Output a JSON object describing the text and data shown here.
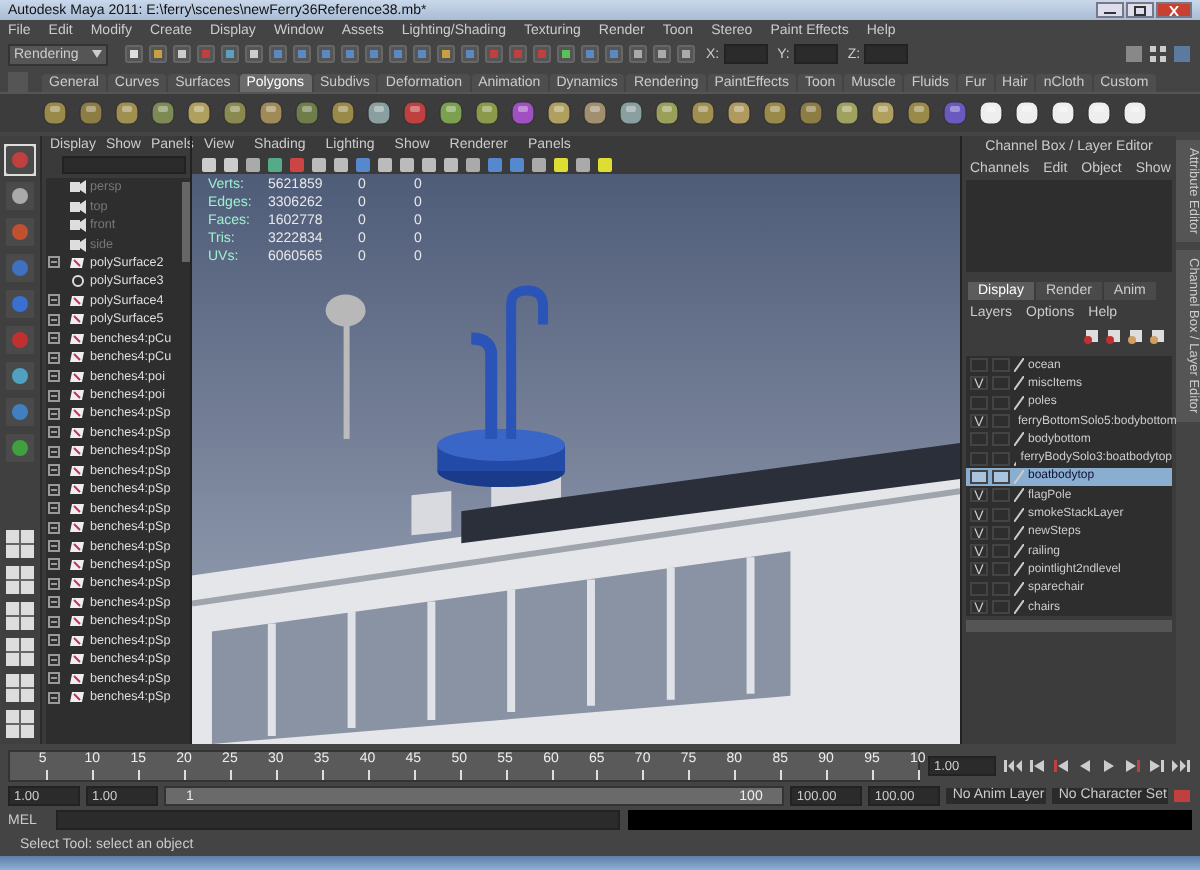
{
  "window": {
    "title": "Autodesk Maya 2011: E:\\ferry\\scenes\\newFerry36Reference38.mb*"
  },
  "menu_bar": [
    "File",
    "Edit",
    "Modify",
    "Create",
    "Display",
    "Window",
    "Assets",
    "Lighting/Shading",
    "Texturing",
    "Render",
    "Toon",
    "Stereo",
    "Paint Effects",
    "Help"
  ],
  "status_line": {
    "mode": "Rendering",
    "coords": [
      "X:",
      "Y:",
      "Z:"
    ]
  },
  "shelf_tabs": [
    {
      "label": "General",
      "selected": false
    },
    {
      "label": "Curves",
      "selected": false
    },
    {
      "label": "Surfaces",
      "selected": false
    },
    {
      "label": "Polygons",
      "selected": true
    },
    {
      "label": "Subdivs",
      "selected": false
    },
    {
      "label": "Deformation",
      "selected": false
    },
    {
      "label": "Animation",
      "selected": false
    },
    {
      "label": "Dynamics",
      "selected": false
    },
    {
      "label": "Rendering",
      "selected": false
    },
    {
      "label": "PaintEffects",
      "selected": false
    },
    {
      "label": "Toon",
      "selected": false
    },
    {
      "label": "Muscle",
      "selected": false
    },
    {
      "label": "Fluids",
      "selected": false
    },
    {
      "label": "Fur",
      "selected": false
    },
    {
      "label": "Hair",
      "selected": false
    },
    {
      "label": "nCloth",
      "selected": false
    },
    {
      "label": "Custom",
      "selected": false
    }
  ],
  "outliner": {
    "menus": [
      "Display",
      "Show",
      "Panels"
    ],
    "items": [
      {
        "name": "persp",
        "kind": "camera",
        "expandable": false
      },
      {
        "name": "top",
        "kind": "camera",
        "expandable": false
      },
      {
        "name": "front",
        "kind": "camera",
        "expandable": false
      },
      {
        "name": "side",
        "kind": "camera",
        "expandable": false
      },
      {
        "name": "polySurface2",
        "kind": "mesh",
        "expandable": true
      },
      {
        "name": "polySurface3",
        "kind": "group",
        "expandable": false
      },
      {
        "name": "polySurface4",
        "kind": "mesh",
        "expandable": true
      },
      {
        "name": "polySurface5",
        "kind": "mesh",
        "expandable": true
      },
      {
        "name": "benches4:pCu",
        "kind": "mesh",
        "expandable": true
      },
      {
        "name": "benches4:pCu",
        "kind": "mesh",
        "expandable": true
      },
      {
        "name": "benches4:poi",
        "kind": "mesh",
        "expandable": true
      },
      {
        "name": "benches4:poi",
        "kind": "mesh",
        "expandable": true
      },
      {
        "name": "benches4:pSp",
        "kind": "mesh",
        "expandable": true
      },
      {
        "name": "benches4:pSp",
        "kind": "mesh",
        "expandable": true
      },
      {
        "name": "benches4:pSp",
        "kind": "mesh",
        "expandable": true
      },
      {
        "name": "benches4:pSp",
        "kind": "mesh",
        "expandable": true
      },
      {
        "name": "benches4:pSp",
        "kind": "mesh",
        "expandable": true
      },
      {
        "name": "benches4:pSp",
        "kind": "mesh",
        "expandable": true
      },
      {
        "name": "benches4:pSp",
        "kind": "mesh",
        "expandable": true
      },
      {
        "name": "benches4:pSp",
        "kind": "mesh",
        "expandable": true
      },
      {
        "name": "benches4:pSp",
        "kind": "mesh",
        "expandable": true
      },
      {
        "name": "benches4:pSp",
        "kind": "mesh",
        "expandable": true
      },
      {
        "name": "benches4:pSp",
        "kind": "mesh",
        "expandable": true
      },
      {
        "name": "benches4:pSp",
        "kind": "mesh",
        "expandable": true
      },
      {
        "name": "benches4:pSp",
        "kind": "mesh",
        "expandable": true
      },
      {
        "name": "benches4:pSp",
        "kind": "mesh",
        "expandable": true
      },
      {
        "name": "benches4:pSp",
        "kind": "mesh",
        "expandable": true
      },
      {
        "name": "benches4:pSp",
        "kind": "mesh",
        "expandable": true
      }
    ]
  },
  "viewport": {
    "menus": [
      "View",
      "Shading",
      "Lighting",
      "Show",
      "Renderer",
      "Panels"
    ],
    "hud": [
      {
        "label": "Verts:",
        "values": [
          "5621859",
          "0",
          "0"
        ]
      },
      {
        "label": "Edges:",
        "values": [
          "3306262",
          "0",
          "0"
        ]
      },
      {
        "label": "Faces:",
        "values": [
          "1602778",
          "0",
          "0"
        ]
      },
      {
        "label": "Tris:",
        "values": [
          "3222834",
          "0",
          "0"
        ]
      },
      {
        "label": "UVs:",
        "values": [
          "6060565",
          "0",
          "0"
        ]
      }
    ]
  },
  "channel_box": {
    "title": "Channel Box / Layer Editor",
    "menus": [
      "Channels",
      "Edit",
      "Object",
      "Show"
    ]
  },
  "layer_editor": {
    "tabs": [
      {
        "label": "Display",
        "selected": true
      },
      {
        "label": "Render",
        "selected": false
      },
      {
        "label": "Anim",
        "selected": false
      }
    ],
    "menus": [
      "Layers",
      "Options",
      "Help"
    ],
    "layers": [
      {
        "name": "ocean",
        "selected": false
      },
      {
        "name": "miscItems",
        "visibility": "V",
        "selected": false
      },
      {
        "name": "poles",
        "selected": false
      },
      {
        "name": "ferryBottomSolo5:bodybottom",
        "visibility": "V",
        "selected": false
      },
      {
        "name": "bodybottom",
        "selected": false
      },
      {
        "name": "ferryBodySolo3:boatbodytop",
        "selected": false
      },
      {
        "name": "boatbodytop",
        "selected": true
      },
      {
        "name": "flagPole",
        "visibility": "V",
        "selected": false
      },
      {
        "name": "smokeStackLayer",
        "visibility": "V",
        "selected": false
      },
      {
        "name": "newSteps",
        "visibility": "V",
        "selected": false
      },
      {
        "name": "railing",
        "visibility": "V",
        "selected": false
      },
      {
        "name": "pointlight2ndlevel",
        "visibility": "V",
        "selected": false
      },
      {
        "name": "sparechair",
        "selected": false
      },
      {
        "name": "chairs",
        "visibility": "V",
        "selected": false
      }
    ]
  },
  "side_tabs": [
    "Attribute Editor",
    "Channel Box / Layer Editor"
  ],
  "time_slider": {
    "ticks": [
      "5",
      "10",
      "15",
      "20",
      "25",
      "30",
      "35",
      "40",
      "45",
      "50",
      "55",
      "60",
      "65",
      "70",
      "75",
      "80",
      "85",
      "90",
      "95",
      "10"
    ],
    "current": "1.00"
  },
  "range_slider": {
    "start": "1.00",
    "inner_start": "1.00",
    "range_start": "1",
    "range_end": "100",
    "inner_end": "100.00",
    "end": "100.00",
    "anim_layer": "No Anim Layer",
    "character_set": "No Character Set"
  },
  "command_line": {
    "label": "MEL"
  },
  "help_line": "Select Tool: select an object"
}
